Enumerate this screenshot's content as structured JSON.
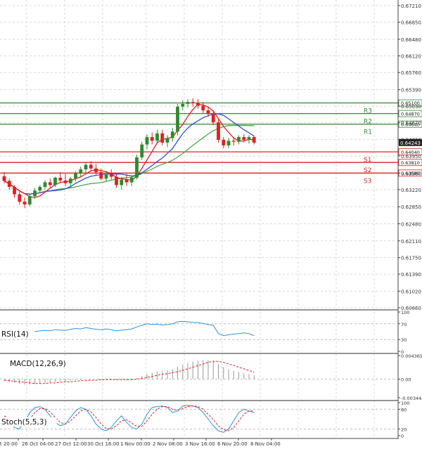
{
  "chart_data": {
    "type": "candlestick",
    "price_axis": {
      "labels": [
        "0.67210",
        "0.66850",
        "0.66480",
        "0.66120",
        "0.65760",
        "0.65390",
        "0.65030",
        "0.64670",
        "0.64310",
        "0.63950",
        "0.63580",
        "0.63220",
        "0.62850",
        "0.62480",
        "0.62110",
        "0.61750",
        "0.61390",
        "0.61020",
        "0.60660"
      ],
      "values": [
        0.6721,
        0.6685,
        0.6648,
        0.6612,
        0.6576,
        0.6539,
        0.6503,
        0.6467,
        0.6431,
        0.6395,
        0.6358,
        0.6322,
        0.6285,
        0.6248,
        0.6211,
        0.6175,
        0.6139,
        0.6102,
        0.6066
      ],
      "range": [
        0.6066,
        0.6721
      ]
    },
    "time_axis": [
      "ct 20:00",
      "26 Oct 04:00",
      "27 Oct 12:00",
      "30 Oct 16:00",
      "1 Nov 00:00",
      "2 Nov 08:00",
      "3 Nov 16:00",
      "6 Nov 20:00",
      "8 Nov 04:00"
    ],
    "current_price": {
      "label": "0.64243",
      "value": 0.64243
    },
    "levels": [
      {
        "name": "R3",
        "value": 0.651,
        "label": "0.65100",
        "color": "#2e8b2e"
      },
      {
        "name": "R2",
        "value": 0.6487,
        "label": "0.64870",
        "color": "#2e8b2e"
      },
      {
        "name": "R1",
        "value": 0.6464,
        "label": "0.64640",
        "color": "#2e8b2e"
      },
      {
        "name": "S1",
        "value": 0.6404,
        "label": "0.64040",
        "color": "#e02020"
      },
      {
        "name": "S2",
        "value": 0.6381,
        "label": "0.63810",
        "color": "#e02020"
      },
      {
        "name": "S3",
        "value": 0.6358,
        "label": "0.63580",
        "color": "#e02020"
      }
    ],
    "candles": [
      [
        0.6351,
        0.636,
        0.6336,
        0.6341
      ],
      [
        0.6341,
        0.6346,
        0.6322,
        0.6328
      ],
      [
        0.6328,
        0.6332,
        0.6305,
        0.6312
      ],
      [
        0.6312,
        0.6318,
        0.629,
        0.6296
      ],
      [
        0.6296,
        0.6305,
        0.6282,
        0.629
      ],
      [
        0.629,
        0.6312,
        0.6286,
        0.6308
      ],
      [
        0.6308,
        0.6326,
        0.6302,
        0.632
      ],
      [
        0.632,
        0.6332,
        0.6314,
        0.6328
      ],
      [
        0.6328,
        0.6342,
        0.6322,
        0.6338
      ],
      [
        0.6338,
        0.6346,
        0.6326,
        0.6332
      ],
      [
        0.6332,
        0.635,
        0.6328,
        0.6348
      ],
      [
        0.6348,
        0.636,
        0.6336,
        0.6342
      ],
      [
        0.6342,
        0.6356,
        0.633,
        0.6336
      ],
      [
        0.6336,
        0.635,
        0.6326,
        0.6346
      ],
      [
        0.6346,
        0.6362,
        0.634,
        0.6358
      ],
      [
        0.6358,
        0.6372,
        0.635,
        0.6366
      ],
      [
        0.6366,
        0.638,
        0.6358,
        0.6376
      ],
      [
        0.6376,
        0.6384,
        0.6362,
        0.6368
      ],
      [
        0.6368,
        0.6378,
        0.6354,
        0.636
      ],
      [
        0.636,
        0.6368,
        0.6342,
        0.6346
      ],
      [
        0.6346,
        0.6362,
        0.634,
        0.6356
      ],
      [
        0.6356,
        0.6366,
        0.6344,
        0.635
      ],
      [
        0.635,
        0.6356,
        0.6326,
        0.6332
      ],
      [
        0.6332,
        0.635,
        0.6322,
        0.6344
      ],
      [
        0.6344,
        0.6356,
        0.633,
        0.6338
      ],
      [
        0.6338,
        0.6352,
        0.633,
        0.6348
      ],
      [
        0.6348,
        0.6398,
        0.6344,
        0.6392
      ],
      [
        0.6392,
        0.6426,
        0.6386,
        0.642
      ],
      [
        0.642,
        0.6442,
        0.641,
        0.6436
      ],
      [
        0.6436,
        0.6446,
        0.642,
        0.6428
      ],
      [
        0.6428,
        0.6452,
        0.6422,
        0.6444
      ],
      [
        0.6444,
        0.6452,
        0.6418,
        0.6424
      ],
      [
        0.6424,
        0.644,
        0.6414,
        0.6434
      ],
      [
        0.6434,
        0.6456,
        0.6426,
        0.6448
      ],
      [
        0.6448,
        0.6508,
        0.644,
        0.6502
      ],
      [
        0.6502,
        0.6516,
        0.6494,
        0.6508
      ],
      [
        0.6508,
        0.6518,
        0.65,
        0.6512
      ],
      [
        0.6512,
        0.652,
        0.6502,
        0.651
      ],
      [
        0.651,
        0.6518,
        0.6498,
        0.6504
      ],
      [
        0.6504,
        0.6512,
        0.6488,
        0.6494
      ],
      [
        0.6494,
        0.6502,
        0.648,
        0.6486
      ],
      [
        0.6486,
        0.6492,
        0.6462,
        0.6468
      ],
      [
        0.6468,
        0.6474,
        0.6424,
        0.643
      ],
      [
        0.643,
        0.6436,
        0.6412,
        0.6418
      ],
      [
        0.6418,
        0.6434,
        0.6412,
        0.6428
      ],
      [
        0.6428,
        0.6436,
        0.6418,
        0.6426
      ],
      [
        0.6426,
        0.644,
        0.642,
        0.6436
      ],
      [
        0.6436,
        0.6442,
        0.6424,
        0.643
      ],
      [
        0.643,
        0.644,
        0.6422,
        0.6436
      ],
      [
        0.6436,
        0.6438,
        0.642,
        0.6424
      ]
    ],
    "indicators": [
      {
        "name": "RSI(14)",
        "axis_labels": [
          "100",
          "70",
          "30",
          "0"
        ],
        "axis_values": [
          100,
          70,
          30,
          0
        ],
        "values": [
          45,
          43,
          41,
          40,
          42,
          48,
          50,
          52,
          53,
          52,
          55,
          54,
          53,
          56,
          58,
          57,
          60,
          58,
          56,
          55,
          57,
          55,
          52,
          54,
          55,
          57,
          62,
          66,
          70,
          68,
          69,
          67,
          68,
          70,
          75,
          76,
          75,
          74,
          73,
          71,
          68,
          66,
          45,
          40,
          42,
          44,
          45,
          47,
          45,
          40
        ]
      },
      {
        "name": "MACD(12,26,9)",
        "axis_labels": [
          "0.004365",
          "0.00",
          "-0.003448"
        ],
        "axis_values": [
          0.004365,
          0,
          -0.003448
        ],
        "histogram": [
          -0.0003,
          -0.0005,
          -0.0007,
          -0.0009,
          -0.001,
          -0.001,
          -0.0009,
          -0.0008,
          -0.0007,
          -0.0006,
          -0.0005,
          -0.0004,
          -0.0004,
          -0.0003,
          -0.0002,
          -0.0002,
          -0.0001,
          0.0,
          0.0,
          -0.0001,
          -0.0001,
          -0.0001,
          -0.0002,
          -0.0002,
          -0.0002,
          -0.0002,
          0.0002,
          0.0006,
          0.001,
          0.0012,
          0.0014,
          0.0015,
          0.0016,
          0.0018,
          0.0023,
          0.0027,
          0.003,
          0.0032,
          0.0034,
          0.0035,
          0.0035,
          0.0034,
          0.0028,
          0.0022,
          0.0018,
          0.0015,
          0.0013,
          0.0011,
          0.0009,
          0.0007
        ],
        "signal": [
          -0.0002,
          -0.0003,
          -0.0004,
          -0.0005,
          -0.0006,
          -0.0007,
          -0.0008,
          -0.0008,
          -0.0008,
          -0.0007,
          -0.0007,
          -0.0006,
          -0.0005,
          -0.0005,
          -0.0004,
          -0.0003,
          -0.0003,
          -0.0002,
          -0.0002,
          -0.0001,
          -0.0001,
          -0.0001,
          -0.0001,
          -0.0001,
          -0.0001,
          -0.0001,
          0.0,
          0.0001,
          0.0003,
          0.0005,
          0.0007,
          0.0009,
          0.001,
          0.0012,
          0.0014,
          0.0016,
          0.0019,
          0.0022,
          0.0025,
          0.0028,
          0.0031,
          0.0033,
          0.0033,
          0.0031,
          0.0028,
          0.0025,
          0.0022,
          0.0019,
          0.0016,
          0.0013
        ]
      },
      {
        "name": "Stoch(5,5,3)",
        "axis_labels": [
          "100",
          "80",
          "20",
          "0"
        ],
        "axis_values": [
          100,
          80,
          20,
          0
        ],
        "k": [
          55,
          40,
          25,
          20,
          40,
          70,
          85,
          88,
          80,
          60,
          40,
          30,
          35,
          55,
          75,
          85,
          80,
          60,
          35,
          20,
          15,
          25,
          45,
          60,
          40,
          25,
          20,
          35,
          65,
          85,
          88,
          90,
          85,
          70,
          75,
          90,
          92,
          90,
          85,
          70,
          50,
          30,
          15,
          10,
          20,
          45,
          70,
          80,
          75,
          70
        ],
        "d": [
          60,
          50,
          35,
          28,
          30,
          50,
          70,
          82,
          82,
          72,
          55,
          40,
          35,
          45,
          60,
          75,
          80,
          72,
          55,
          35,
          22,
          20,
          30,
          45,
          48,
          38,
          28,
          28,
          45,
          65,
          80,
          88,
          88,
          80,
          77,
          82,
          88,
          90,
          88,
          80,
          65,
          48,
          30,
          18,
          15,
          25,
          45,
          65,
          75,
          75
        ]
      }
    ],
    "colors": {
      "up": "#2e8b2e",
      "down": "#e02020",
      "ma_blue": "#3050d0",
      "ma_red": "#e02020",
      "ma_green": "#4aa84a",
      "rsi": "#3090e0",
      "stoch_k": "#3090e0",
      "stoch_d": "#e02020"
    }
  }
}
